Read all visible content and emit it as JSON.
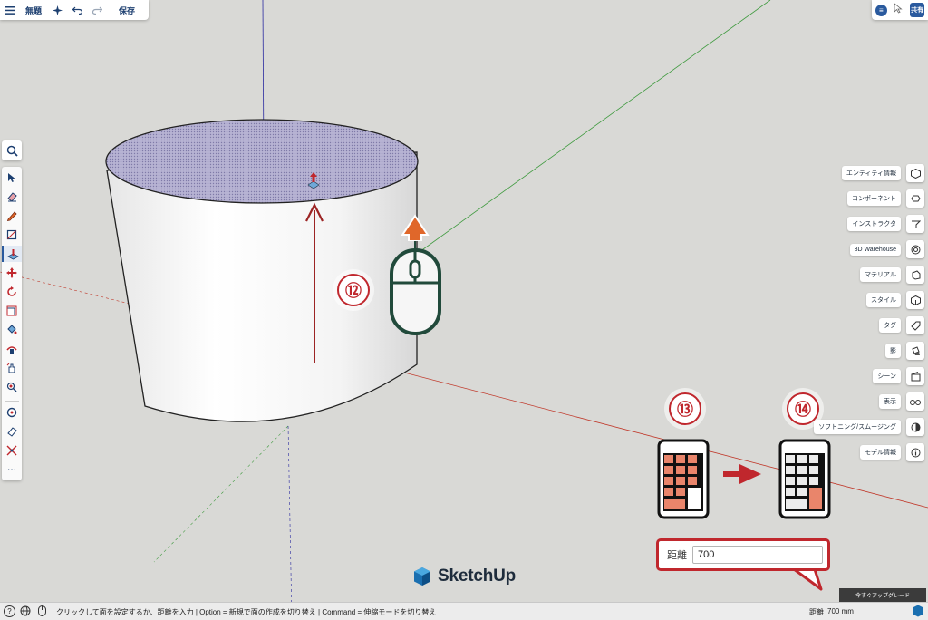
{
  "header": {
    "menu_icon": "hamburger-icon",
    "title": "無題",
    "magic_icon": "sparkle-icon",
    "undo_icon": "undo-icon",
    "redo_icon": "redo-icon",
    "save_label": "保存"
  },
  "top_right": {
    "collab_icon": "layers-icon",
    "share_label": "共有"
  },
  "left_toolbar": {
    "tools": [
      "search-icon",
      "select-icon",
      "eraser-icon",
      "pencil-icon",
      "rectangle-icon",
      "push-pull-icon",
      "move-icon",
      "rotate-icon",
      "scale-icon",
      "paint-bucket-icon",
      "follow-me-icon",
      "orbit-icon",
      "zoom-icon",
      "tape-measure-icon",
      "text-icon",
      "axes-icon",
      "more-icon"
    ],
    "active_tool": "push-pull-icon"
  },
  "right_panel": {
    "items": [
      {
        "label": "エンティティ情報",
        "icon": "entity-icon"
      },
      {
        "label": "コンポーネント",
        "icon": "component-icon"
      },
      {
        "label": "インストラクタ",
        "icon": "instructor-icon"
      },
      {
        "label": "3D Warehouse",
        "icon": "warehouse-icon"
      },
      {
        "label": "マテリアル",
        "icon": "material-icon"
      },
      {
        "label": "スタイル",
        "icon": "style-icon"
      },
      {
        "label": "タグ",
        "icon": "tag-icon"
      },
      {
        "label": "影",
        "icon": "shadow-icon"
      },
      {
        "label": "シーン",
        "icon": "scene-icon"
      },
      {
        "label": "表示",
        "icon": "display-icon"
      },
      {
        "label": "ソフトニング/スムージング",
        "icon": "soften-icon"
      },
      {
        "label": "モデル情報",
        "icon": "info-icon"
      }
    ]
  },
  "annotations": {
    "step12": "⑫",
    "step13": "⑬",
    "step14": "⑭"
  },
  "vcb_callout": {
    "label": "距離",
    "value": "700"
  },
  "logo": {
    "text": "SketchUp"
  },
  "upgrade_button": {
    "label": "今すぐアップグレード"
  },
  "status_bar": {
    "message": "クリックして面を設定するか、距離を入力 | Option = 新規で面の作成を切り替え | Command = 伸縮モードを切り替え",
    "measure_label": "距離",
    "measure_value": "700 mm"
  },
  "colors": {
    "accent_red": "#c0272d",
    "keypad_orange": "#e9856b",
    "mouse_green": "#214a3b",
    "arrow_orange": "#e0672a",
    "brand_blue": "#2a5a9e"
  }
}
